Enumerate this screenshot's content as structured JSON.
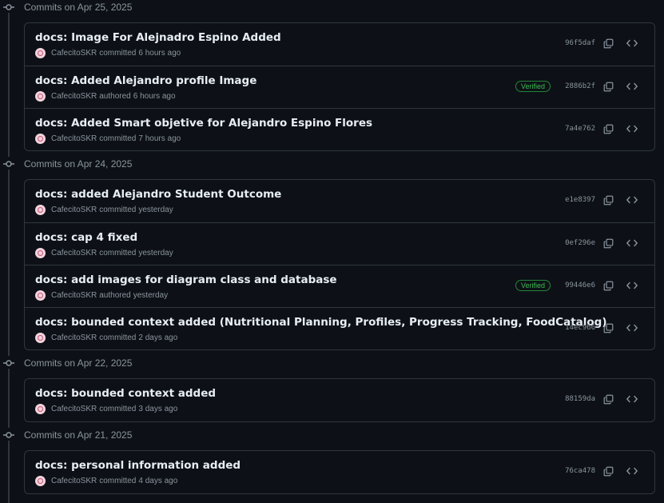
{
  "groups": [
    {
      "title": "Commits on Apr 25, 2025",
      "commits": [
        {
          "message": "docs: Image For Alejnadro Espino Added",
          "author": "CafecitoSKR",
          "verb": "committed",
          "time": "6 hours ago",
          "sha": "96f5daf",
          "verified": ""
        },
        {
          "message": "docs: Added Alejandro profile Image",
          "author": "CafecitoSKR",
          "verb": "authored",
          "time": "6 hours ago",
          "sha": "2886b2f",
          "verified": "Verified"
        },
        {
          "message": "docs: Added Smart objetive for Alejandro Espino Flores",
          "author": "CafecitoSKR",
          "verb": "committed",
          "time": "7 hours ago",
          "sha": "7a4e762",
          "verified": ""
        }
      ]
    },
    {
      "title": "Commits on Apr 24, 2025",
      "commits": [
        {
          "message": "docs: added Alejandro Student Outcome",
          "author": "CafecitoSKR",
          "verb": "committed",
          "time": "yesterday",
          "sha": "e1e8397",
          "verified": ""
        },
        {
          "message": "docs: cap 4 fixed",
          "author": "CafecitoSKR",
          "verb": "committed",
          "time": "yesterday",
          "sha": "0ef296e",
          "verified": ""
        },
        {
          "message": "docs: add images for diagram class and database",
          "author": "CafecitoSKR",
          "verb": "authored",
          "time": "yesterday",
          "sha": "99446e6",
          "verified": "Verified"
        },
        {
          "message": "docs: bounded context added (Nutritional Planning, Profiles, Progress Tracking, FoodCatalog)",
          "author": "CafecitoSKR",
          "verb": "committed",
          "time": "2 days ago",
          "sha": "14ec966",
          "verified": ""
        }
      ]
    },
    {
      "title": "Commits on Apr 22, 2025",
      "commits": [
        {
          "message": "docs: bounded context added",
          "author": "CafecitoSKR",
          "verb": "committed",
          "time": "3 days ago",
          "sha": "88159da",
          "verified": ""
        }
      ]
    },
    {
      "title": "Commits on Apr 21, 2025",
      "commits": [
        {
          "message": "docs: personal information added",
          "author": "CafecitoSKR",
          "verb": "committed",
          "time": "4 days ago",
          "sha": "76ca478",
          "verified": ""
        }
      ]
    }
  ],
  "icons": {
    "commit": "git-commit-icon",
    "copy": "copy-icon",
    "browse": "code-browse-icon",
    "avatar": "avatar"
  },
  "colors": {
    "background": "#0d1117",
    "border": "#30363d",
    "text": "#e6edf3",
    "muted": "#8b949e",
    "verified": "#3fb950"
  }
}
